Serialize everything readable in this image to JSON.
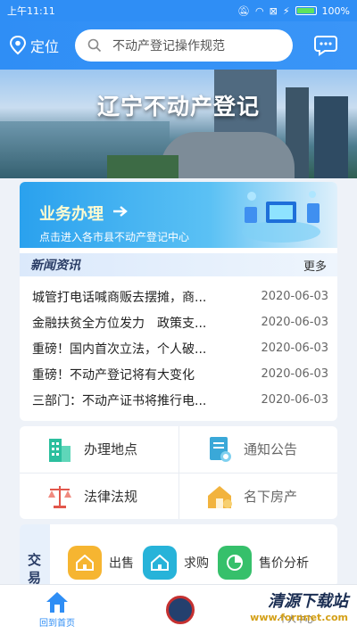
{
  "status_bar": {
    "time": "上午11:11",
    "battery": "100%"
  },
  "header": {
    "location_label": "定位",
    "search_placeholder": "不动产登记操作规范"
  },
  "banner": {
    "title": "辽宁不动产登记"
  },
  "service": {
    "title": "业务办理",
    "subtitle": "点击进入各市县不动产登记中心"
  },
  "news": {
    "title": "新闻资讯",
    "more_label": "更多",
    "items": [
      {
        "text": "城管打电话喊商贩去摆摊，商...",
        "date": "2020-06-03"
      },
      {
        "text": "金融扶贫全方位发力　政策支...",
        "date": "2020-06-03"
      },
      {
        "text": "重磅！国内首次立法，个人破...",
        "date": "2020-06-03"
      },
      {
        "text": "重磅！不动产登记将有大变化",
        "date": "2020-06-03"
      },
      {
        "text": "三部门：不动产证书将推行电...",
        "date": "2020-06-03"
      }
    ]
  },
  "grid": {
    "items": [
      {
        "label": "办理地点",
        "icon": "building-icon",
        "color": "#2bbf9e"
      },
      {
        "label": "通知公告",
        "icon": "notice-icon",
        "color": "#3aa8d8"
      },
      {
        "label": "法律法规",
        "icon": "scales-icon",
        "color": "#e2574c"
      },
      {
        "label": "名下房产",
        "icon": "house-icon",
        "color": "#f2b33d"
      }
    ]
  },
  "trade": {
    "label": "交易",
    "items": [
      {
        "label": "出售",
        "icon": "house-icon",
        "color": "#f6b531"
      },
      {
        "label": "求购",
        "icon": "house-icon",
        "color": "#27b3d9"
      },
      {
        "label": "售价分析",
        "icon": "pie-chart-icon",
        "color": "#36c06b"
      }
    ]
  },
  "tab_bar": {
    "home_label": "回到首页",
    "profile_label": "个人中心",
    "watermark_title": "清源下载站",
    "watermark_url": "www.fornnet.com"
  },
  "colors": {
    "primary": "#2f8ef5",
    "accent_text": "#2a3d66"
  }
}
